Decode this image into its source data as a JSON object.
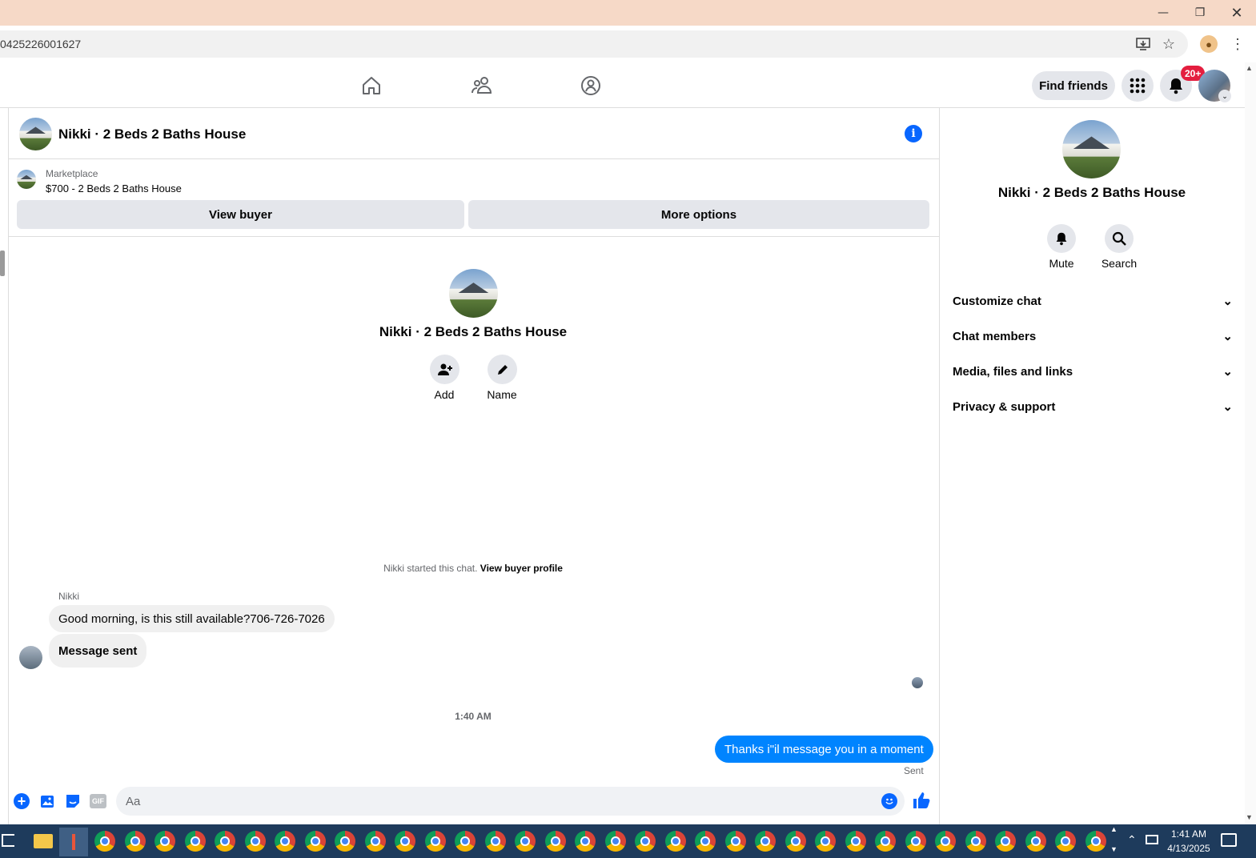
{
  "browser": {
    "url": "0425226001627",
    "window_controls": [
      "minimize",
      "restore",
      "close"
    ]
  },
  "topnav": {
    "find_friends": "Find friends",
    "notif_badge": "20+"
  },
  "chat": {
    "title": "Nikki · 2 Beds 2 Baths House",
    "marketplace_label": "Marketplace",
    "listing": "$700 - 2 Beds 2 Baths House",
    "view_buyer": "View buyer",
    "more_options": "More options",
    "center_name": "Nikki · 2 Beds 2 Baths House",
    "add_label": "Add",
    "name_label": "Name",
    "started_text": "Nikki started this chat.",
    "view_buyer_profile": "View buyer profile",
    "sender_name": "Nikki",
    "msg1": "Good morning, is this still available?706-726-7026",
    "msg2": "Message sent",
    "time": "1:40 AM",
    "outgoing": "Thanks i\"il message you in a moment",
    "sent_status": "Sent",
    "composer_placeholder": "Aa"
  },
  "sidebar": {
    "name": "Nikki · 2 Beds 2 Baths House",
    "mute": "Mute",
    "search": "Search",
    "items": [
      {
        "label": "Customize chat"
      },
      {
        "label": "Chat members"
      },
      {
        "label": "Media, files and links"
      },
      {
        "label": "Privacy & support"
      }
    ]
  },
  "taskbar": {
    "time": "1:41 AM",
    "date": "4/13/2025"
  },
  "colors": {
    "accent": "#0084ff",
    "titlebar": "#f6d9c7",
    "badge": "#e41e3f"
  }
}
